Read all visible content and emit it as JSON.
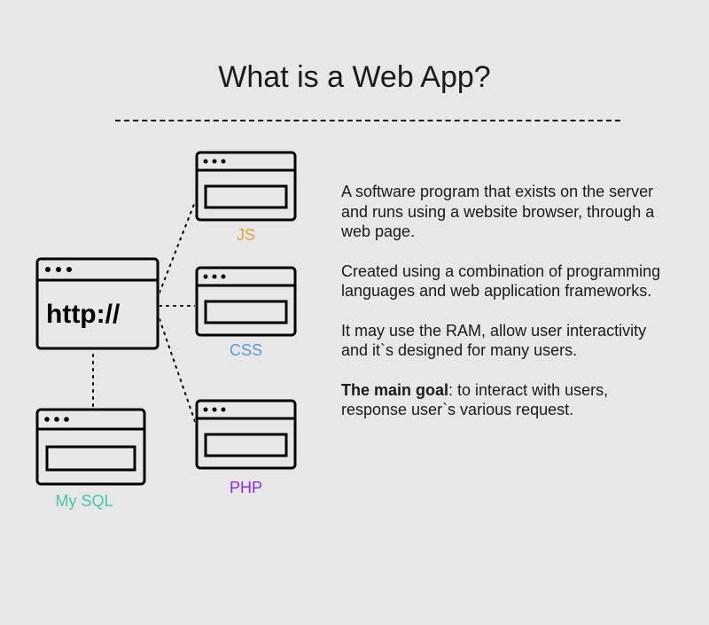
{
  "title": "What is a Web App?",
  "diagram": {
    "main_label": "http://",
    "nodes": {
      "js": {
        "label": "JS",
        "color": "#e0a23c"
      },
      "css": {
        "label": "CSS",
        "color": "#5b9bd5"
      },
      "php": {
        "label": "PHP",
        "color": "#8a2be2"
      },
      "mysql": {
        "label": "My SQL",
        "color": "#46c7a8"
      }
    }
  },
  "description": {
    "p1": "A software program that exists on the server and runs using a website browser, through a web page.",
    "p2": "Created using a combination of programming languages and web application frameworks.",
    "p3": "It may use the RAM, allow user interactivity and it`s designed for many users.",
    "p4_lead": "The main goal",
    "p4_rest": ": to interact with users, response user`s various request."
  }
}
